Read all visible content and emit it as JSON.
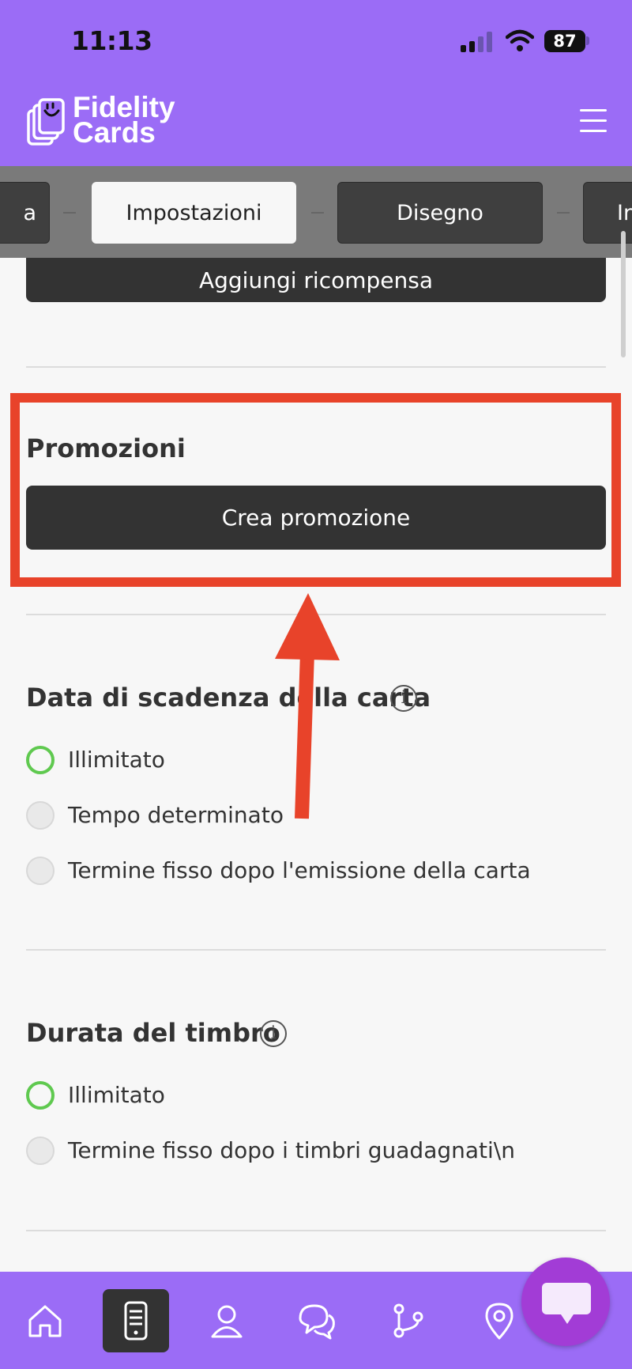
{
  "status_bar": {
    "time": "11:13",
    "battery": "87"
  },
  "header": {
    "brand_line1": "Fidelity",
    "brand_line2": "Cards"
  },
  "tabs": [
    {
      "label": "a"
    },
    {
      "label": "Impostazioni",
      "active": true
    },
    {
      "label": "Disegno"
    },
    {
      "label": "In"
    }
  ],
  "content": {
    "add_reward_label": "Aggiungi ricompensa",
    "promotions": {
      "title": "Promozioni",
      "button_label": "Crea promozione"
    },
    "card_expiry": {
      "title": "Data di scadenza della carta",
      "options": [
        {
          "label": "Illimitato",
          "selected": true
        },
        {
          "label": "Tempo determinato",
          "selected": false
        },
        {
          "label": "Termine fisso dopo l'emissione della carta",
          "selected": false
        }
      ]
    },
    "stamp_duration": {
      "title": "Durata del timbro",
      "options": [
        {
          "label": "Illimitato",
          "selected": true
        },
        {
          "label": "Termine fisso dopo i timbri guadagnati\\n",
          "selected": false
        }
      ]
    }
  },
  "colors": {
    "brand_purple": "#9b6cf6",
    "highlight_red": "#e8432a",
    "radio_selected": "#5fc94f",
    "button_dark": "#333333",
    "chat_fab": "#a23cd6"
  },
  "bottom_nav": {
    "items": [
      {
        "icon": "home-icon"
      },
      {
        "icon": "card-device-icon",
        "active": true
      },
      {
        "icon": "users-icon"
      },
      {
        "icon": "chat-icon"
      },
      {
        "icon": "branch-icon"
      },
      {
        "icon": "location-pin-icon"
      }
    ]
  }
}
